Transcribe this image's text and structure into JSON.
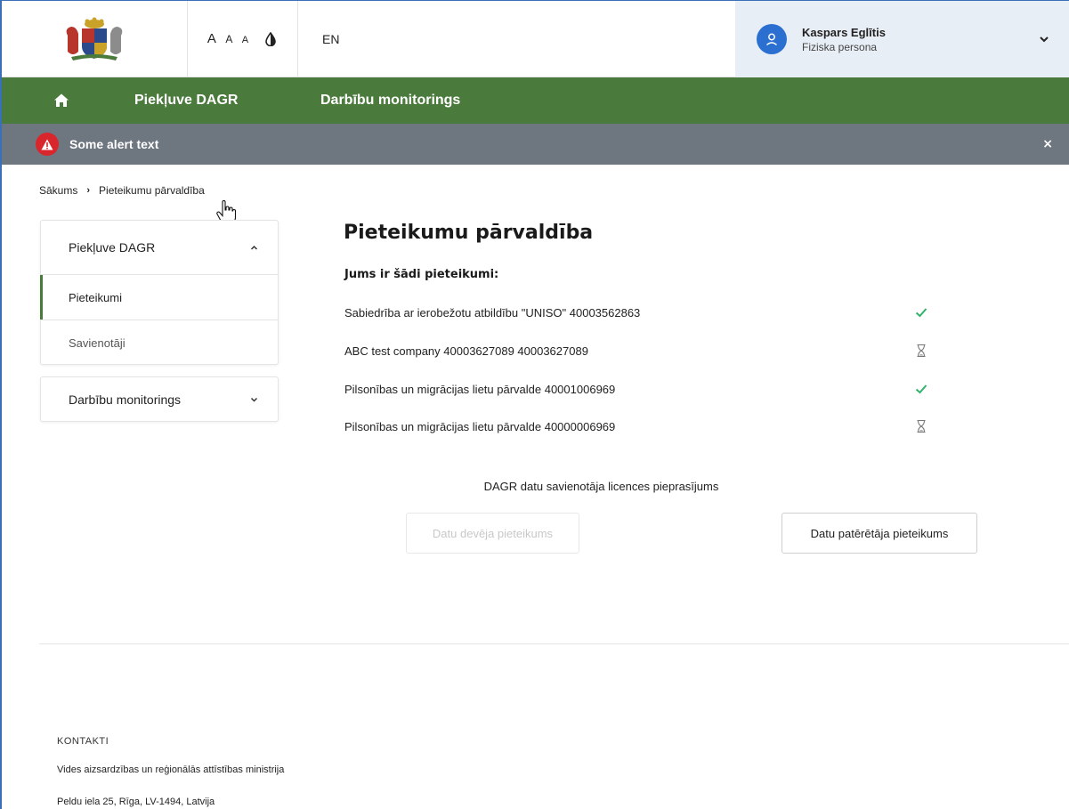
{
  "header": {
    "logo_icon": "coat-of-arms-icon",
    "font_size_labels": [
      "A",
      "A",
      "A"
    ],
    "contrast_icon": "contrast-drop-icon",
    "language": "EN",
    "user": {
      "name": "Kaspars Eglītis",
      "role": "Fiziska persona",
      "avatar_icon": "user-icon"
    }
  },
  "nav": {
    "home_icon": "home-icon",
    "items": [
      {
        "label": "Piekļuve DAGR"
      },
      {
        "label": "Darbību monitorings"
      }
    ]
  },
  "alert": {
    "text": "Some alert text",
    "close": "×",
    "color": "#d9262c"
  },
  "breadcrumb": {
    "items": [
      "Sākums",
      "Pieteikumu pārvaldība"
    ]
  },
  "sidebar": {
    "groups": [
      {
        "label": "Piekļuve DAGR",
        "expanded": true,
        "items": [
          {
            "label": "Pieteikumi",
            "active": true
          },
          {
            "label": "Savienotāji",
            "active": false
          }
        ]
      },
      {
        "label": "Darbību monitorings",
        "expanded": false,
        "items": []
      }
    ]
  },
  "main": {
    "title": "Pieteikumu pārvaldība",
    "subtitle": "Jums ir šādi pieteikumi:",
    "applications": [
      {
        "text": "Sabiedrība ar ierobežotu atbildību \"UNISO\" 40003562863",
        "status": "approved-check-icon"
      },
      {
        "text": "ABC test company 40003627089 40003627089",
        "status": "pending-hourglass-icon"
      },
      {
        "text": "Pilsonības un migrācijas lietu pārvalde 40001006969",
        "status": "approved-check-icon"
      },
      {
        "text": "Pilsonības un migrācijas lietu pārvalde 40000006969",
        "status": "pending-hourglass-icon"
      }
    ],
    "license_title": "DAGR datu savienotāja licences pieprasījums",
    "buttons": {
      "provider": "Datu devēja pieteikums",
      "consumer": "Datu patērētāja pieteikums"
    }
  },
  "footer": {
    "heading": "KONTAKTI",
    "org": "Vides aizsardzības un reģionālās attīstības ministrija",
    "address": "Peldu iela 25, Rīga, LV-1494, Latvija"
  },
  "colors": {
    "brand_green": "#4b7b3c",
    "alert_bar": "#6e7680",
    "accent_blue": "#2b6fd1",
    "status_green": "#2fb36a"
  }
}
